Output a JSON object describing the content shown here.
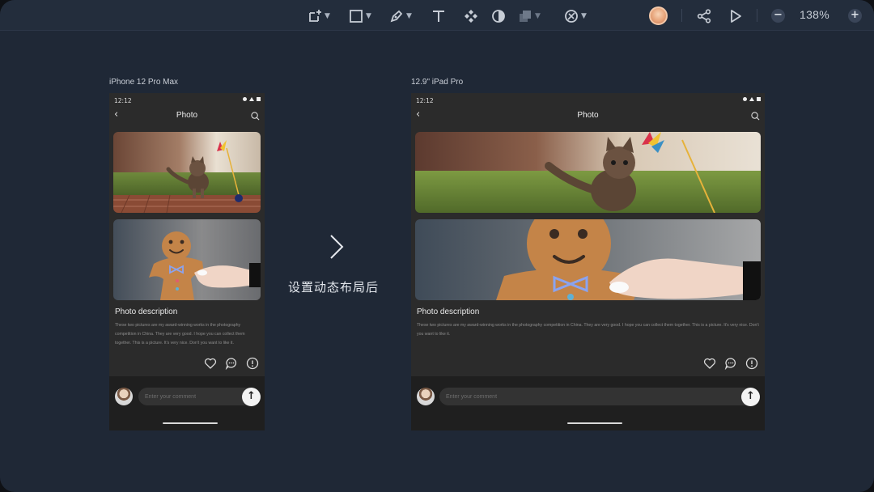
{
  "toolbar": {
    "tools": [
      {
        "icon": "artboard-icon",
        "has_menu": true
      },
      {
        "icon": "rectangle-icon",
        "has_menu": true
      },
      {
        "icon": "pen-icon",
        "has_menu": true
      },
      {
        "icon": "text-icon",
        "has_menu": false
      },
      {
        "icon": "component-icon",
        "has_menu": false
      },
      {
        "icon": "contrast-icon",
        "has_menu": false
      },
      {
        "icon": "boolean-icon",
        "has_menu": true
      },
      {
        "icon": "prototype-icon",
        "has_menu": true
      }
    ],
    "zoom_label": "138%",
    "zoom_out": "−",
    "zoom_in": "+"
  },
  "phone": {
    "label": "iPhone 12 Pro Max",
    "status_time": "12:12",
    "back": "‹",
    "title": "Photo",
    "desc_title": "Photo description",
    "desc_body": "These two pictures are my award-winning works in the photography competition in China. They are very good. I hope you can collect them together.  This is a picture. It's very nice. Don't you want to like it.",
    "comment_placeholder": "Enter your comment",
    "send": "↑"
  },
  "tablet": {
    "label": "12.9\" iPad Pro",
    "status_time": "12:12",
    "back": "‹",
    "title": "Photo",
    "desc_title": "Photo description",
    "desc_body": "These two pictures are my award-winning works in the photography competition in China. They are very good. I hope you can collect them together.  This is a picture. It's very nice. Don't you want to like it.",
    "comment_placeholder": "Enter your comment",
    "send": "↑"
  },
  "caption": "设置动态布局后",
  "colors": {
    "window_bg": "#1f2836",
    "toolbar_bg": "#232d3c",
    "device_bg": "#2b2b2b",
    "comment_bar_bg": "#1f1f1f"
  }
}
